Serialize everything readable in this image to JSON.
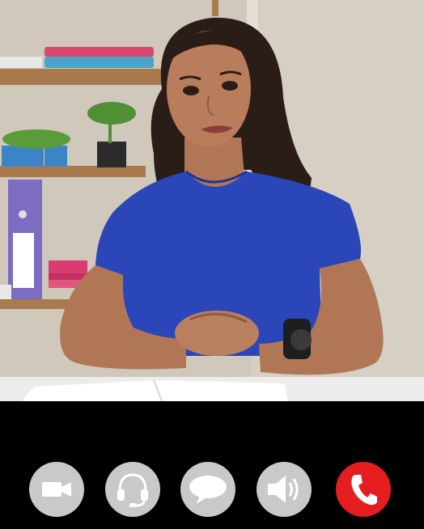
{
  "video": {
    "description_hidden": true
  },
  "controls": [
    {
      "id": "camera",
      "icon": "video-camera-icon",
      "color": "#c9c9c9"
    },
    {
      "id": "headset",
      "icon": "headset-icon",
      "color": "#c9c9c9"
    },
    {
      "id": "chat",
      "icon": "chat-bubble-icon",
      "color": "#c9c9c9"
    },
    {
      "id": "speaker",
      "icon": "speaker-icon",
      "color": "#c9c9c9"
    },
    {
      "id": "end-call",
      "icon": "phone-handset-icon",
      "color": "#e41e1e"
    }
  ],
  "colors": {
    "bar": "#000000",
    "button": "#c9c9c9",
    "end_call": "#e41e1e",
    "icon": "#ffffff"
  }
}
